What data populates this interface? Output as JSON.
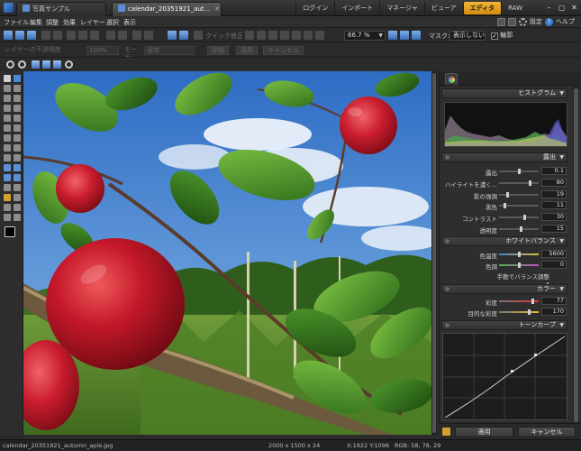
{
  "titlebar": {
    "tabs": [
      {
        "label": "写真サンプル",
        "active": false
      },
      {
        "label": "calendar_20351921_aut...",
        "active": true
      }
    ],
    "modes": [
      "ログイン",
      "インポート",
      "マネージャ",
      "ビューア",
      "エディタ",
      "RAW"
    ],
    "active_mode": "エディタ",
    "window_controls": [
      "minimize",
      "maximize",
      "close"
    ]
  },
  "menubar": {
    "items": [
      "ファイル",
      "編集",
      "調整",
      "効果",
      "レイヤー",
      "選択",
      "表示"
    ],
    "right_items": [
      "設定",
      "ヘルプ"
    ]
  },
  "toolbar": {
    "quick_fix_label": "クイック修正",
    "zoom_value": "66.7 %",
    "mask_label": "マスク:",
    "mask_value": "表示しない",
    "outline_label": "輪郭",
    "outline_checked": true
  },
  "layer_toolbar": {
    "opacity_label": "レイヤーの不透明度",
    "opacity_value": "100%",
    "mode_label": "モード:",
    "mode_value": "通常",
    "btn_edit": "詳細",
    "btn_apply": "適用",
    "btn_cancel": "キャンセル"
  },
  "panel": {
    "histogram_title": "ヒストグラム",
    "exposure_title": "露出",
    "exposure_rows": [
      {
        "label": "露出",
        "value": "0.1",
        "level": 0.52
      },
      {
        "label": "ハイライトを濃く...",
        "value": "80",
        "level": 0.8
      },
      {
        "label": "影の強調",
        "value": "19",
        "level": 0.19
      },
      {
        "label": "黒色",
        "value": "11",
        "level": 0.11
      },
      {
        "label": "コントラスト",
        "value": "30",
        "level": 0.65
      },
      {
        "label": "透明度",
        "value": "15",
        "level": 0.57
      }
    ],
    "wb_title": "ホワイトバランス",
    "wb_rows": [
      {
        "label": "色温度",
        "value": "5600",
        "level": 0.5
      },
      {
        "label": "色調",
        "value": "0",
        "level": 0.5
      }
    ],
    "wb_manual_label": "手動でバランス調整",
    "color_title": "カラー",
    "color_rows": [
      {
        "label": "彩度",
        "value": "77",
        "level": 0.88
      },
      {
        "label": "目的な彩度",
        "value": "170",
        "level": 0.78
      }
    ],
    "tone_curve_title": "トーンカーブ"
  },
  "actions": {
    "apply": "適用",
    "cancel": "キャンセル"
  },
  "status": {
    "filename": "calendar_20351921_autumn_aple.jpg",
    "dimensions": "2000 x 1500 x 24",
    "coords": "X:1922 Y:1096",
    "rgb": "RGB: 58, 78, 29"
  }
}
